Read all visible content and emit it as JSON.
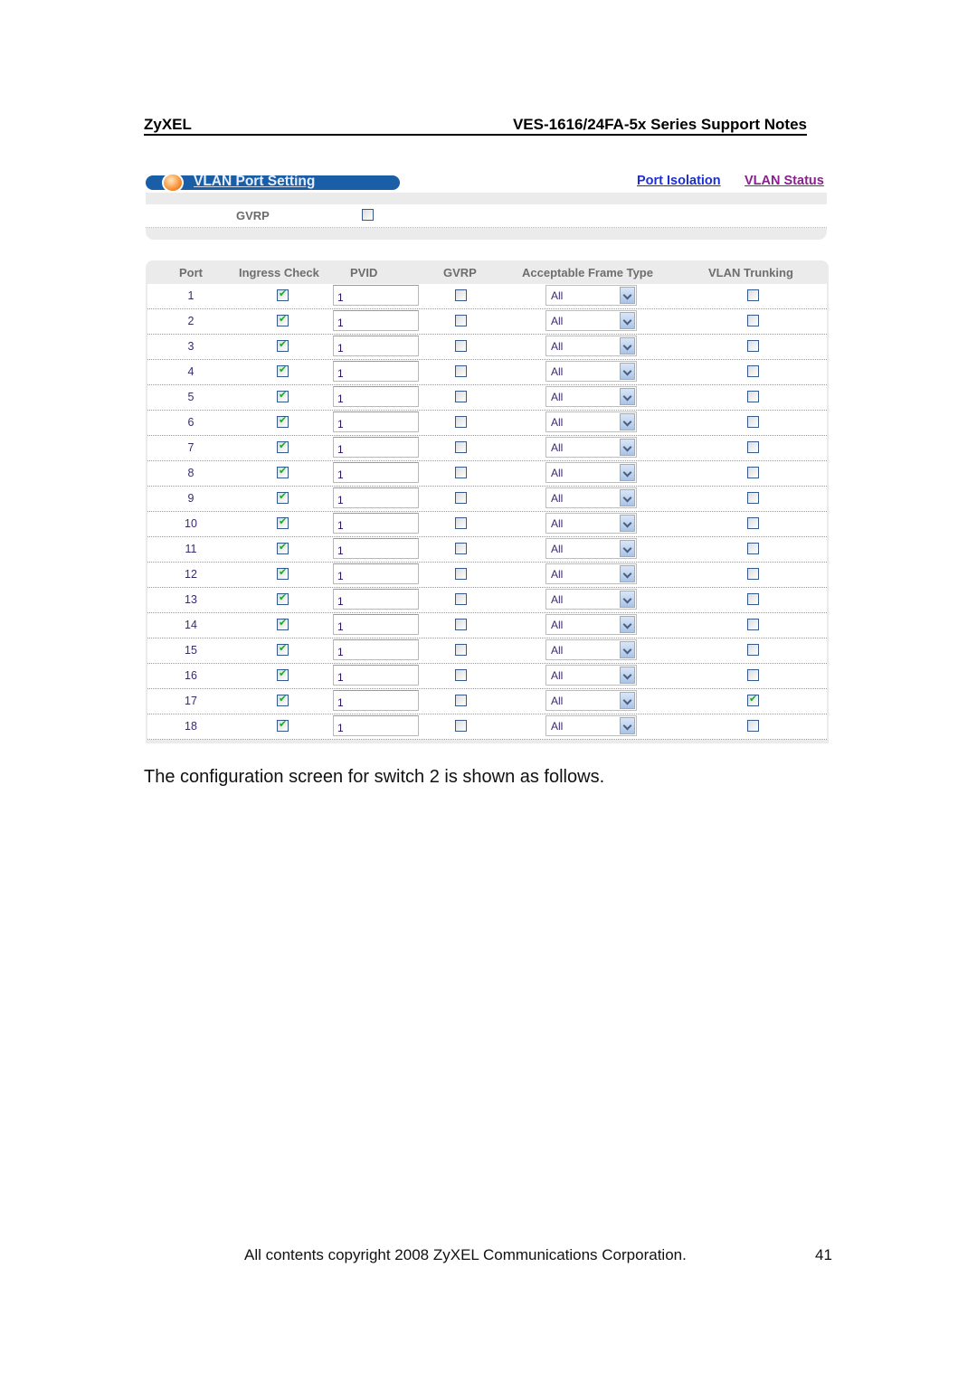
{
  "header": {
    "left": "ZyXEL",
    "right": "VES-1616/24FA-5x Series Support Notes"
  },
  "panel": {
    "title": "VLAN Port Setting",
    "links": {
      "port_isolation": "Port Isolation",
      "vlan_status": "VLAN Status"
    },
    "gvrp": {
      "label": "GVRP",
      "checked": false
    }
  },
  "table": {
    "columns": [
      "Port",
      "Ingress Check",
      "PVID",
      "GVRP",
      "Acceptable Frame Type",
      "VLAN Trunking"
    ],
    "rows": [
      {
        "port": "1",
        "ingress": true,
        "pvid": "1",
        "gvrp": false,
        "frame_type": "All",
        "trunking": false
      },
      {
        "port": "2",
        "ingress": true,
        "pvid": "1",
        "gvrp": false,
        "frame_type": "All",
        "trunking": false
      },
      {
        "port": "3",
        "ingress": true,
        "pvid": "1",
        "gvrp": false,
        "frame_type": "All",
        "trunking": false
      },
      {
        "port": "4",
        "ingress": true,
        "pvid": "1",
        "gvrp": false,
        "frame_type": "All",
        "trunking": false
      },
      {
        "port": "5",
        "ingress": true,
        "pvid": "1",
        "gvrp": false,
        "frame_type": "All",
        "trunking": false
      },
      {
        "port": "6",
        "ingress": true,
        "pvid": "1",
        "gvrp": false,
        "frame_type": "All",
        "trunking": false
      },
      {
        "port": "7",
        "ingress": true,
        "pvid": "1",
        "gvrp": false,
        "frame_type": "All",
        "trunking": false
      },
      {
        "port": "8",
        "ingress": true,
        "pvid": "1",
        "gvrp": false,
        "frame_type": "All",
        "trunking": false
      },
      {
        "port": "9",
        "ingress": true,
        "pvid": "1",
        "gvrp": false,
        "frame_type": "All",
        "trunking": false
      },
      {
        "port": "10",
        "ingress": true,
        "pvid": "1",
        "gvrp": false,
        "frame_type": "All",
        "trunking": false
      },
      {
        "port": "11",
        "ingress": true,
        "pvid": "1",
        "gvrp": false,
        "frame_type": "All",
        "trunking": false
      },
      {
        "port": "12",
        "ingress": true,
        "pvid": "1",
        "gvrp": false,
        "frame_type": "All",
        "trunking": false
      },
      {
        "port": "13",
        "ingress": true,
        "pvid": "1",
        "gvrp": false,
        "frame_type": "All",
        "trunking": false
      },
      {
        "port": "14",
        "ingress": true,
        "pvid": "1",
        "gvrp": false,
        "frame_type": "All",
        "trunking": false
      },
      {
        "port": "15",
        "ingress": true,
        "pvid": "1",
        "gvrp": false,
        "frame_type": "All",
        "trunking": false
      },
      {
        "port": "16",
        "ingress": true,
        "pvid": "1",
        "gvrp": false,
        "frame_type": "All",
        "trunking": false
      },
      {
        "port": "17",
        "ingress": true,
        "pvid": "1",
        "gvrp": false,
        "frame_type": "All",
        "trunking": true
      },
      {
        "port": "18",
        "ingress": true,
        "pvid": "1",
        "gvrp": false,
        "frame_type": "All",
        "trunking": false
      }
    ]
  },
  "caption": "The configuration screen for switch 2 is shown as follows.",
  "footer": {
    "copyright": "All contents copyright 2008 ZyXEL Communications Corporation.",
    "page_number": "41"
  }
}
